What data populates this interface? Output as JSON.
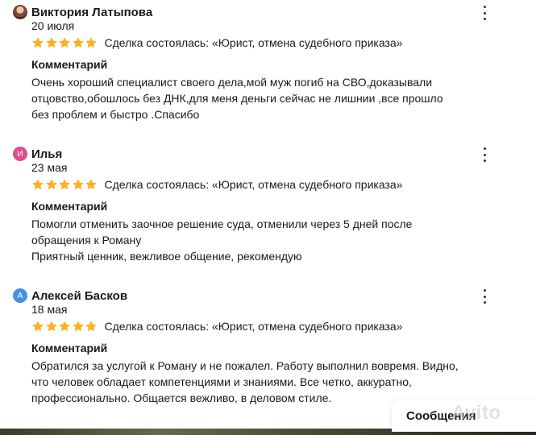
{
  "colors": {
    "star": "#ffb021",
    "avatar_pink": "#d94f8b",
    "avatar_blue": "#4a90e2"
  },
  "reviews": [
    {
      "author": "Виктория Латыпова",
      "avatar_initial": "",
      "date": "20 июля",
      "rating": 5,
      "deal": "Сделка состоялась: «Юрист, отмена судебного приказа»",
      "comment_title": "Комментарий",
      "comment": "Очень хороший специалист своего дела,мой муж погиб на СВО,доказывали\nотцовство,обошлось без ДНК,для меня деньги сейчас не лишнии ,все прошло\nбез проблем и быстро .Спасибо"
    },
    {
      "author": "Илья",
      "avatar_initial": "И",
      "date": "23 мая",
      "rating": 5,
      "deal": "Сделка состоялась: «Юрист, отмена судебного приказа»",
      "comment_title": "Комментарий",
      "comment": "Помогли отменить заочное решение суда, отменили через 5 дней после\nобращения к Роману\nПриятный ценник, вежливое общение, рекомендую"
    },
    {
      "author": "Алексей Басков",
      "avatar_initial": "А",
      "date": "18 мая",
      "rating": 5,
      "deal": "Сделка состоялась: «Юрист, отмена судебного приказа»",
      "comment_title": "Комментарий",
      "comment": "Обратился за услугой к Роману и не пожалел. Работу выполнил вовремя. Видно,\nчто человек обладает компетенциями и знаниями. Все четко, аккуратно,\nпрофессионально. Общается вежливо, в деловом стиле."
    }
  ],
  "messages_button": "Сообщения",
  "watermark": "Avito"
}
